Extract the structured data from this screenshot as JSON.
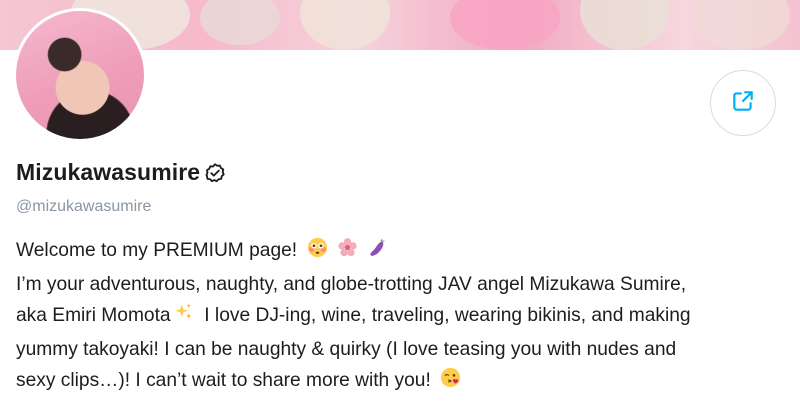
{
  "profile": {
    "display_name": "Mizukawasumire",
    "handle": "@mizukawasumire",
    "verified": true
  },
  "bio": {
    "line1": "Welcome to my PREMIUM page!",
    "line2": "I’m your adventurous, naughty, and globe-trotting JAV angel Mizukawa Sumire,",
    "line3a": "aka Emiri Momota",
    "line3b": "  I love DJ-ing, wine, traveling, wearing bikinis, and making",
    "line4": "yummy takoyaki! I can be naughty & quirky (I love teasing you with nudes and",
    "line5": "sexy clips…)! I can’t wait to share more with you!"
  },
  "icons": {
    "share": "share-icon",
    "verified": "verified-badge-icon",
    "emojis_line1": [
      "flushed-face-emoji",
      "cherry-blossom-emoji",
      "eggplant-emoji"
    ],
    "emoji_line3": "sparkles-emoji",
    "emoji_line5": "face-blowing-kiss-emoji"
  },
  "colors": {
    "accent": "#00aff0",
    "text": "#1d1d1f",
    "muted": "#8a96a3",
    "border": "#d8dce3"
  }
}
